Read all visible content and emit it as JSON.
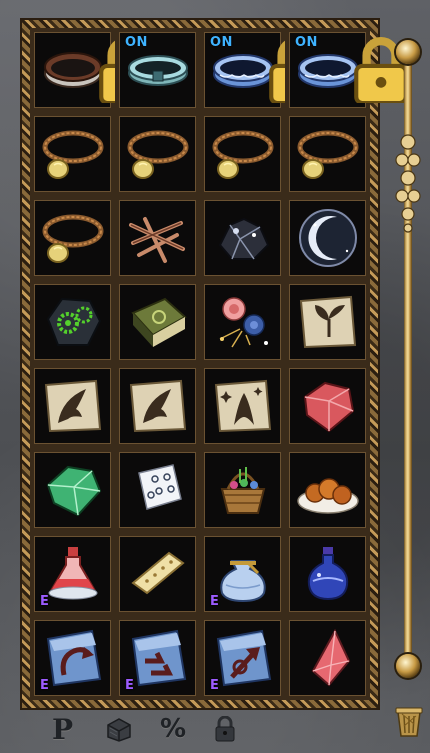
{
  "inventory": {
    "columns": 4,
    "rows": 8,
    "slots": [
      {
        "icon": "brown-ring-icon",
        "on_label": "",
        "locked": true,
        "e_label": ""
      },
      {
        "icon": "silver-collar-icon",
        "on_label": "ON",
        "locked": false,
        "e_label": ""
      },
      {
        "icon": "blue-rune-ring-icon",
        "on_label": "ON",
        "locked": true,
        "e_label": ""
      },
      {
        "icon": "blue-rune-ring-icon",
        "on_label": "ON",
        "locked": true,
        "e_label": ""
      },
      {
        "icon": "gold-pendant-necklace-icon",
        "on_label": "",
        "locked": false,
        "e_label": ""
      },
      {
        "icon": "gold-pendant-necklace-icon",
        "on_label": "",
        "locked": false,
        "e_label": ""
      },
      {
        "icon": "gold-pendant-necklace-icon",
        "on_label": "",
        "locked": false,
        "e_label": ""
      },
      {
        "icon": "gold-pendant-necklace-icon",
        "on_label": "",
        "locked": false,
        "e_label": ""
      },
      {
        "icon": "gold-pendant-necklace-icon",
        "on_label": "",
        "locked": false,
        "e_label": ""
      },
      {
        "icon": "copper-twigs-icon",
        "on_label": "",
        "locked": false,
        "e_label": ""
      },
      {
        "icon": "dark-ore-icon",
        "on_label": "",
        "locked": false,
        "e_label": ""
      },
      {
        "icon": "crescent-moon-orb-icon",
        "on_label": "",
        "locked": false,
        "e_label": ""
      },
      {
        "icon": "green-gear-stone-icon",
        "on_label": "",
        "locked": false,
        "e_label": ""
      },
      {
        "icon": "green-tome-icon",
        "on_label": "",
        "locked": false,
        "e_label": ""
      },
      {
        "icon": "rose-bouquet-icon",
        "on_label": "",
        "locked": false,
        "e_label": ""
      },
      {
        "icon": "sprout-scroll-icon",
        "on_label": "",
        "locked": false,
        "e_label": ""
      },
      {
        "icon": "wing-scroll-icon",
        "on_label": "",
        "locked": false,
        "e_label": ""
      },
      {
        "icon": "wing-scroll-icon",
        "on_label": "",
        "locked": false,
        "e_label": ""
      },
      {
        "icon": "sparkle-scroll-icon",
        "on_label": "",
        "locked": false,
        "e_label": ""
      },
      {
        "icon": "red-gem-icon",
        "on_label": "",
        "locked": false,
        "e_label": ""
      },
      {
        "icon": "green-gem-icon",
        "on_label": "",
        "locked": false,
        "e_label": ""
      },
      {
        "icon": "lace-cloth-icon",
        "on_label": "",
        "locked": false,
        "e_label": ""
      },
      {
        "icon": "gift-basket-icon",
        "on_label": "",
        "locked": false,
        "e_label": ""
      },
      {
        "icon": "fried-food-plate-icon",
        "on_label": "",
        "locked": false,
        "e_label": ""
      },
      {
        "icon": "red-potion-icon",
        "on_label": "",
        "locked": false,
        "e_label": "E"
      },
      {
        "icon": "biscuit-bar-icon",
        "on_label": "",
        "locked": false,
        "e_label": ""
      },
      {
        "icon": "blue-pouch-icon",
        "on_label": "",
        "locked": false,
        "e_label": "E"
      },
      {
        "icon": "blue-potion-icon",
        "on_label": "",
        "locked": false,
        "e_label": ""
      },
      {
        "icon": "return-scroll-icon",
        "on_label": "",
        "locked": false,
        "e_label": "E"
      },
      {
        "icon": "teleport-scroll-icon",
        "on_label": "",
        "locked": false,
        "e_label": "E"
      },
      {
        "icon": "arrow-up-scroll-icon",
        "on_label": "",
        "locked": false,
        "e_label": "E"
      },
      {
        "icon": "red-shard-icon",
        "on_label": "",
        "locked": false,
        "e_label": ""
      }
    ]
  },
  "bottom_bar": {
    "p_label": "P",
    "percent_label": "%",
    "icons": [
      "chest-icon",
      "padlock-icon",
      "trash-bin-icon"
    ]
  },
  "colors": {
    "on": "#3fb3ff",
    "e": "#9d5cff",
    "frame": "#c9a56a"
  }
}
